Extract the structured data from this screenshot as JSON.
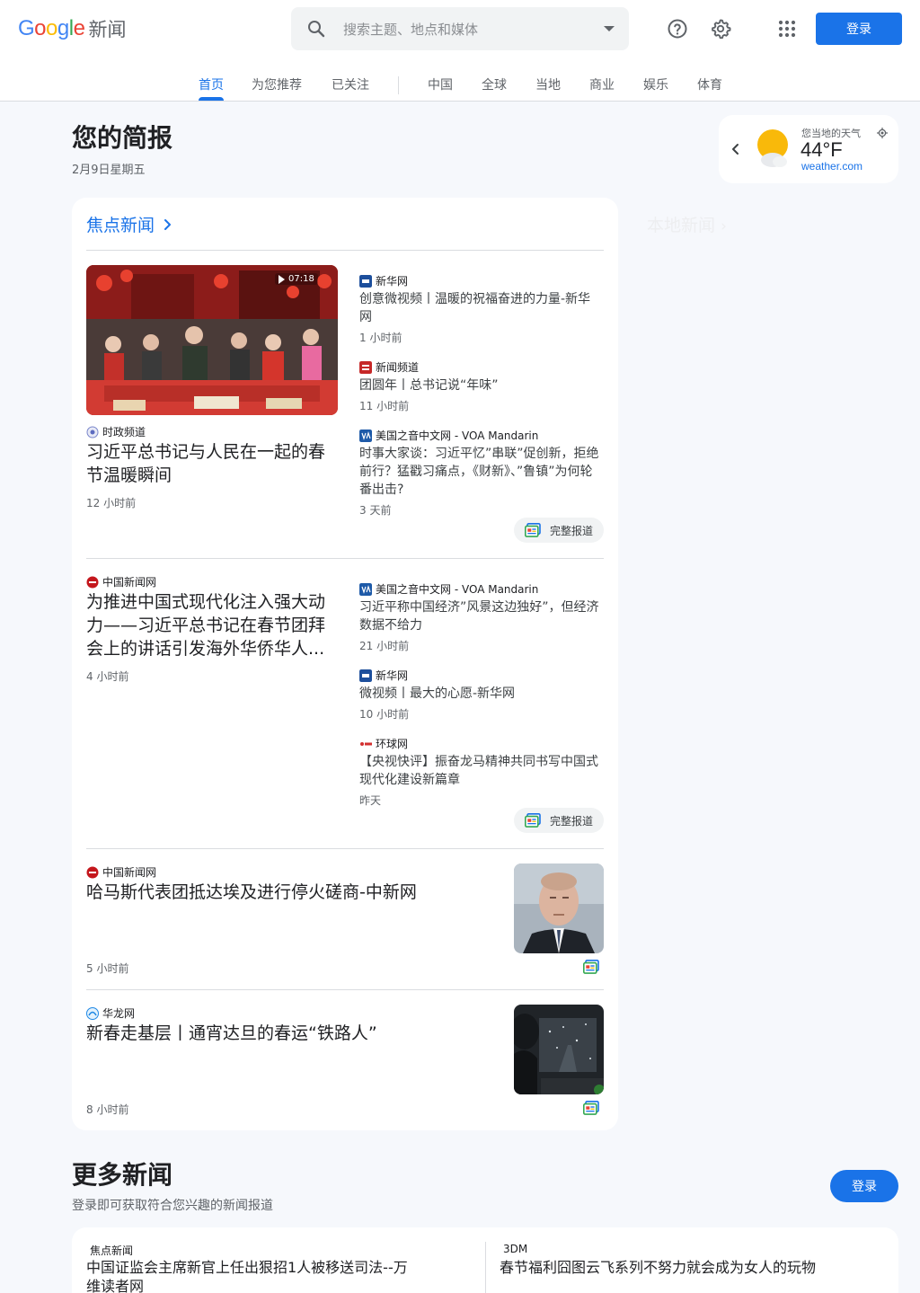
{
  "header": {
    "logo_word": "Google",
    "logo_suffix": "新闻",
    "search_placeholder": "搜索主题、地点和媒体",
    "login": "登录"
  },
  "nav": {
    "tabs": [
      "首页",
      "为您推荐",
      "已关注",
      "中国",
      "全球",
      "当地",
      "商业",
      "娱乐",
      "体育"
    ],
    "active": "首页"
  },
  "briefing": {
    "title": "您的简报",
    "date": "2月9日星期五"
  },
  "weather": {
    "label": "您当地的天气",
    "temp": "44°F",
    "source": "weather.com"
  },
  "local_news": {
    "title": "本地新闻"
  },
  "top_stories": {
    "title": "焦点新闻",
    "full_coverage": "完整报道",
    "cluster1": {
      "video_duration": "07:18",
      "main": {
        "source": "时政频道",
        "title": "习近平总书记与人民在一起的春节温暖瞬间",
        "time": "12 小时前"
      },
      "side": [
        {
          "source": "新华网",
          "title": "创意微视频丨温暖的祝福奋进的力量-新华网",
          "time": "1 小时前"
        },
        {
          "source": "新闻频道",
          "title": "团圆年丨总书记说“年味”",
          "time": "11 小时前"
        },
        {
          "source": "美国之音中文网 - VOA Mandarin",
          "title": "时事大家谈：习近平忆”串联”促创新，拒绝前行？猛戳习痛点，《财新》、”鲁镇”为何轮番出击?",
          "time": "3 天前"
        }
      ]
    },
    "cluster2": {
      "main": {
        "source": "中国新闻网",
        "title": "为推进中国式现代化注入强大动力——习近平总书记在春节团拜会上的讲话引发海外华侨华人...",
        "time": "4 小时前"
      },
      "side": [
        {
          "source": "美国之音中文网 - VOA Mandarin",
          "title": "习近平称中国经济”风景这边独好”，但经济数据不给力",
          "time": "21 小时前"
        },
        {
          "source": "新华网",
          "title": "微视频丨最大的心愿-新华网",
          "time": "10 小时前"
        },
        {
          "source": "环球网",
          "title": "【央视快评】振奋龙马精神共同书写中国式现代化建设新篇章",
          "time": "昨天"
        }
      ]
    },
    "single1": {
      "source": "中国新闻网",
      "title": "哈马斯代表团抵达埃及进行停火磋商-中新网",
      "time": "5 小时前"
    },
    "single2": {
      "source": "华龙网",
      "title": "新春走基层丨通宵达旦的春运“铁路人”",
      "time": "8 小时前"
    }
  },
  "more_news": {
    "title": "更多新闻",
    "subtitle": "登录即可获取符合您兴趣的新闻报道",
    "login": "登录",
    "items": [
      {
        "source": "焦点新闻",
        "title": "中国证监会主席新官上任出狠招1人被移送司法--万维读者网"
      },
      {
        "source": "3DM",
        "title": "春节福利囧图云飞系列不努力就会成为女人的玩物"
      }
    ]
  },
  "colors": {
    "accent": "#1a73e8",
    "card": "#ffffff",
    "page_bg": "#f6f8fc"
  }
}
